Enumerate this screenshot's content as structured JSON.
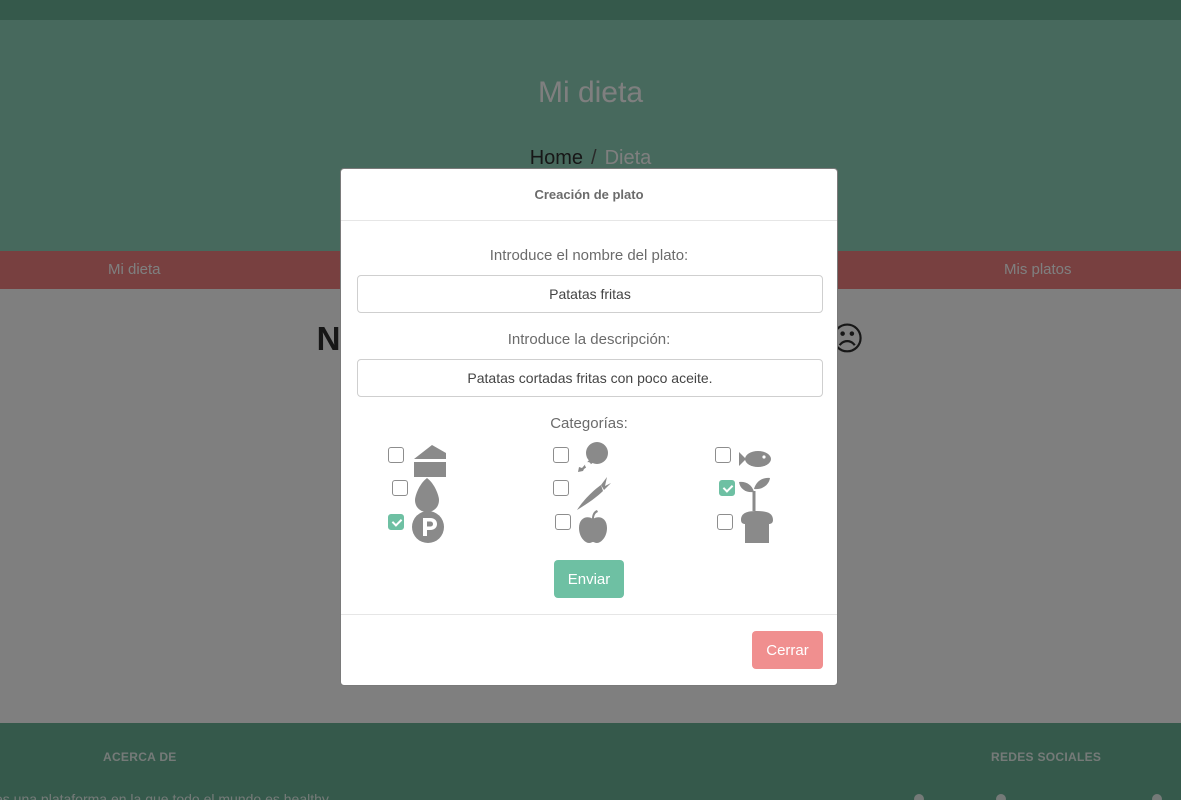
{
  "hero": {
    "title": "Mi dieta"
  },
  "breadcrumb": {
    "home": "Home",
    "separator": "/",
    "current": "Dieta"
  },
  "tabs": {
    "left": "Mi dieta",
    "right": "Mis platos"
  },
  "main": {
    "empty_message": "No tienes una dieta actualmente ☹"
  },
  "footer": {
    "about_heading": "ACERCA DE",
    "social_heading": "REDES SOCIALES",
    "about_text": "es una plataforma en la que todo el mundo es healthy"
  },
  "modal": {
    "title": "Creación de plato",
    "name_label": "Introduce el nombre del plato:",
    "name_value": "Patatas fritas",
    "desc_label": "Introduce la descripción:",
    "desc_value": "Patatas cortadas fritas con poco aceite.",
    "categories_label": "Categorías:",
    "categories": [
      {
        "icon": "cheese-icon",
        "checked": false
      },
      {
        "icon": "chicken-leg-icon",
        "checked": false
      },
      {
        "icon": "fish-icon",
        "checked": false
      },
      {
        "icon": "egg-icon",
        "checked": false
      },
      {
        "icon": "carrot-icon",
        "checked": false
      },
      {
        "icon": "sprout-icon",
        "checked": true
      },
      {
        "icon": "parking-p-icon",
        "checked": true
      },
      {
        "icon": "apple-icon",
        "checked": false
      },
      {
        "icon": "bread-icon",
        "checked": false
      }
    ],
    "submit_label": "Enviar",
    "close_label": "Cerrar"
  },
  "colors": {
    "accent": "#6ec0a3",
    "danger": "#f08f8f",
    "icon": "#8a8a8a"
  }
}
